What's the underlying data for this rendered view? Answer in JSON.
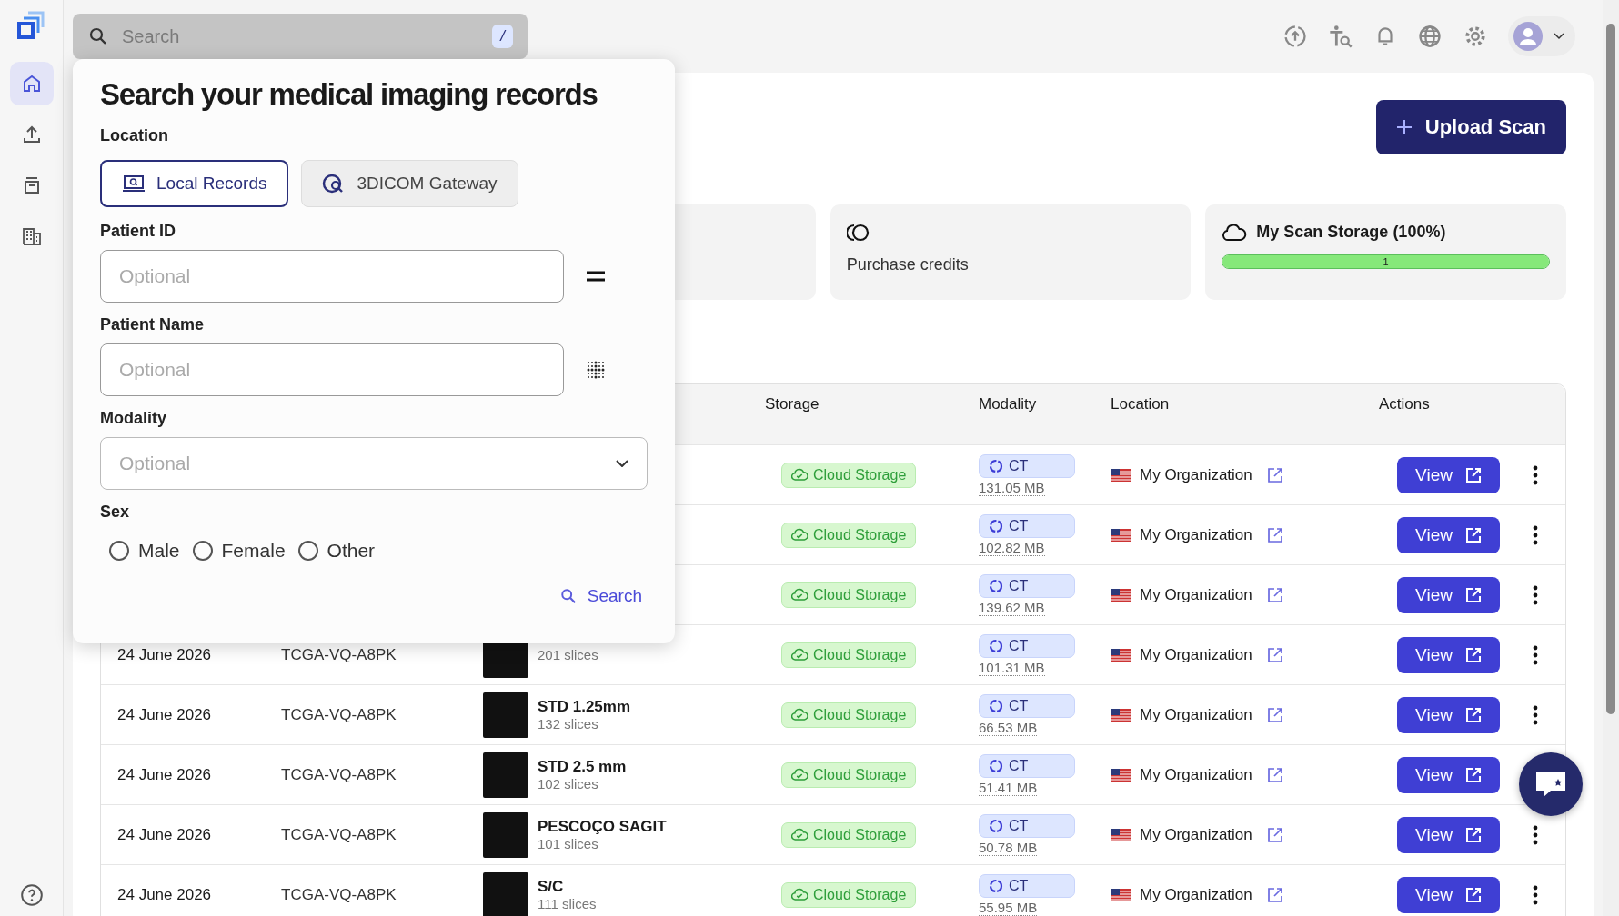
{
  "sidebar": {
    "items": [
      {
        "kind": "home",
        "selected": true
      },
      {
        "kind": "upload",
        "selected": false
      },
      {
        "kind": "archive",
        "selected": false
      },
      {
        "kind": "building",
        "selected": false
      }
    ]
  },
  "search": {
    "placeholder": "Search",
    "shortcut": "/"
  },
  "upload_button": "Upload Scan",
  "stat_cards": [
    {
      "kind": "credits",
      "label": "Purchase credits"
    },
    {
      "kind": "storage",
      "label": "My Scan Storage (100%)",
      "level": 1,
      "reading": "1"
    }
  ],
  "search_popup": {
    "title": "Search your medical imaging records",
    "location_label": "Location",
    "locations": [
      {
        "kind": "local",
        "label": "Local Records",
        "selected": true
      },
      {
        "kind": "gateway",
        "label": "3DICOM Gateway",
        "selected": false
      }
    ],
    "fields": [
      {
        "kind": "exact",
        "label": "Patient ID",
        "placeholder": "Optional"
      },
      {
        "kind": "fuzzy",
        "label": "Patient Name",
        "placeholder": "Optional"
      },
      {
        "kind": "select",
        "label": "Modality",
        "placeholder": "Optional"
      }
    ],
    "sex_label": "Sex",
    "sex_options": [
      {
        "label": "Male",
        "checked": false
      },
      {
        "label": "Female",
        "checked": false
      },
      {
        "label": "Other",
        "checked": false
      }
    ],
    "search_button": "Search"
  },
  "table": {
    "columns": [
      "Storage",
      "Modality",
      "Location",
      "Actions"
    ],
    "rows": [
      {
        "storage": "Cloud Storage",
        "modality": "CT",
        "size": "131.05 MB",
        "location": "My Organization",
        "action": "View"
      },
      {
        "storage": "Cloud Storage",
        "modality": "CT",
        "size": "102.82 MB",
        "location": "My Organization",
        "action": "View"
      },
      {
        "storage": "Cloud Storage",
        "modality": "CT",
        "size": "139.62 MB",
        "location": "My Organization",
        "action": "View"
      },
      {
        "date": "24 June 2026",
        "patient_id": "TCGA-VQ-A8PK",
        "slices": "201 slices",
        "storage": "Cloud Storage",
        "modality": "CT",
        "size": "101.31 MB",
        "location": "My Organization",
        "action": "View"
      },
      {
        "date": "24 June 2026",
        "patient_id": "TCGA-VQ-A8PK",
        "series": "STD 1.25mm",
        "slices": "132 slices",
        "storage": "Cloud Storage",
        "modality": "CT",
        "size": "66.53 MB",
        "location": "My Organization",
        "action": "View"
      },
      {
        "date": "24 June 2026",
        "patient_id": "TCGA-VQ-A8PK",
        "series": "STD 2.5 mm",
        "slices": "102 slices",
        "storage": "Cloud Storage",
        "modality": "CT",
        "size": "51.41 MB",
        "location": "My Organization",
        "action": "View"
      },
      {
        "date": "24 June 2026",
        "patient_id": "TCGA-VQ-A8PK",
        "series": "PESCOÇO SAGIT",
        "slices": "101 slices",
        "storage": "Cloud Storage",
        "modality": "CT",
        "size": "50.78 MB",
        "location": "My Organization",
        "action": "View"
      },
      {
        "date": "24 June 2026",
        "patient_id": "TCGA-VQ-A8PK",
        "series": "S/C",
        "slices": "111 slices",
        "storage": "Cloud Storage",
        "modality": "CT",
        "size": "55.95 MB",
        "location": "My Organization",
        "action": "View"
      }
    ]
  }
}
